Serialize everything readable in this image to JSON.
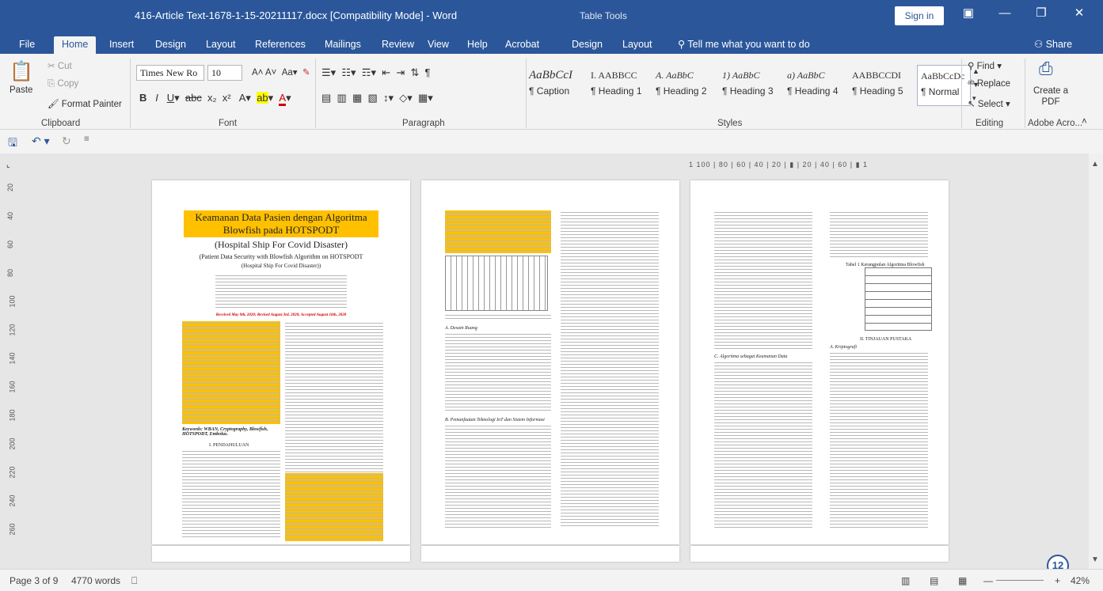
{
  "titlebar": {
    "doc_title": "416-Article Text-1678-1-15-20211117.docx [Compatibility Mode] - Word",
    "context_tools": "Table Tools",
    "sign_in": "Sign in",
    "share": "Share"
  },
  "tabs": [
    "File",
    "Home",
    "Insert",
    "Design",
    "Layout",
    "References",
    "Mailings",
    "Review",
    "View",
    "Help",
    "Acrobat",
    "Design",
    "Layout"
  ],
  "active_tab": "Home",
  "tell_me": "Tell me what you want to do",
  "ribbon": {
    "clipboard": {
      "label": "Clipboard",
      "paste": "Paste",
      "cut": "Cut",
      "copy": "Copy",
      "format_painter": "Format Painter"
    },
    "font": {
      "label": "Font",
      "font_name": "Times New Ro",
      "font_size": "10"
    },
    "paragraph": {
      "label": "Paragraph"
    },
    "styles": {
      "label": "Styles",
      "items": [
        {
          "preview": "AaBbCcI",
          "name": "¶ Caption"
        },
        {
          "preview": "I. AABBCC",
          "name": "¶ Heading 1"
        },
        {
          "preview": "A. AaBbC",
          "name": "¶ Heading 2"
        },
        {
          "preview": "1) AaBbC",
          "name": "¶ Heading 3"
        },
        {
          "preview": "a) AaBbC",
          "name": "¶ Heading 4"
        },
        {
          "preview": "AABBCCDI",
          "name": "¶ Heading 5"
        },
        {
          "preview": "AaBbCcDc",
          "name": "¶ Normal"
        }
      ]
    },
    "editing": {
      "label": "Editing",
      "find": "Find",
      "replace": "Replace",
      "select": "Select"
    },
    "adobe": {
      "label": "Adobe Acro...",
      "create_pdf": "Create a PDF"
    }
  },
  "ruler": {
    "h_text": "1 100 | 80 | 60 | 40 | 20 | ▮ | 20 | 40 | 60 | ▮ 1",
    "v_ticks": [
      "20",
      "40",
      "60",
      "80",
      "100",
      "120",
      "140",
      "160",
      "180",
      "200",
      "220",
      "240",
      "260"
    ]
  },
  "page1": {
    "title": "Keamanan Data Pasien dengan Algoritma Blowfish pada HOTSPODT",
    "subtitle": "(Hospital Ship For Covid Disaster)",
    "en_title": "(Patient Data Security with Blowfish Algorithm on HOTSPODT",
    "en_sub": "(Hospital Ship For Covid Disaster))",
    "received": "Received May 9th, 2020; Revised August 3rd, 2020; Accepted August 16th, 2020",
    "keywords": "Keywords: WBAN, Cryptography, Blowfish, HOTSPODT, Embolus.",
    "section": "I. PENDAHULUAN"
  },
  "page2": {
    "section_a": "A. Desain Ruang",
    "section_b": "B. Pemanfaatan Teknologi IoT dan Sistem Informasi"
  },
  "page3": {
    "section_c": "C. Algoritma sebagai Keamanan Data",
    "table_title": "Tabel 1 Kerangpulan Algoritma Blowfish",
    "section_ii": "II. TINJAUAN PUSTAKA",
    "sub_a": "A. Kriptografi"
  },
  "status": {
    "page": "Page 3 of 9",
    "words": "4770 words",
    "zoom": "42%",
    "badge": "12"
  }
}
